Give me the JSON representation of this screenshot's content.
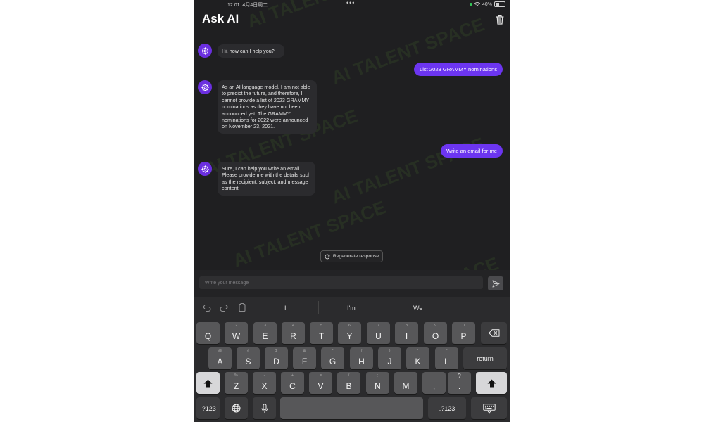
{
  "status_bar": {
    "time": "12:01",
    "date": "4月4日周二",
    "battery": "40%"
  },
  "header": {
    "title": "Ask AI"
  },
  "messages": [
    {
      "role": "ai",
      "text": "Hi, how can I help you?"
    },
    {
      "role": "user",
      "text": "List 2023 GRAMMY nominations"
    },
    {
      "role": "ai",
      "text": "As an AI language model, I am not able to predict the future, and therefore, I cannot provide a list of 2023 GRAMMY nominations as they have not been announced yet. The GRAMMY nominations for 2022 were announced on November 23, 2021."
    },
    {
      "role": "user",
      "text": "Write an email for me"
    },
    {
      "role": "ai",
      "text": "Sure, I can help you write an email. Please provide me with the details such as the recipient, subject, and message content."
    }
  ],
  "regenerate": {
    "label": "Regenerate response"
  },
  "composer": {
    "placeholder": "Write your message",
    "value": ""
  },
  "keyboard": {
    "suggestions": [
      "I",
      "I'm",
      "We"
    ],
    "row1": [
      {
        "hint": "1",
        "main": "Q"
      },
      {
        "hint": "2",
        "main": "W"
      },
      {
        "hint": "3",
        "main": "E"
      },
      {
        "hint": "4",
        "main": "R"
      },
      {
        "hint": "5",
        "main": "T"
      },
      {
        "hint": "6",
        "main": "Y"
      },
      {
        "hint": "7",
        "main": "U"
      },
      {
        "hint": "8",
        "main": "I"
      },
      {
        "hint": "9",
        "main": "O"
      },
      {
        "hint": "0",
        "main": "P"
      }
    ],
    "row2": [
      {
        "hint": "@",
        "main": "A"
      },
      {
        "hint": "#",
        "main": "S"
      },
      {
        "hint": "$",
        "main": "D"
      },
      {
        "hint": "&",
        "main": "F"
      },
      {
        "hint": "*",
        "main": "G"
      },
      {
        "hint": "(",
        "main": "H"
      },
      {
        "hint": ")",
        "main": "J"
      },
      {
        "hint": "'",
        "main": "K"
      },
      {
        "hint": "\"",
        "main": "L"
      }
    ],
    "row3": [
      {
        "hint": "%",
        "main": "Z"
      },
      {
        "hint": "-",
        "main": "X"
      },
      {
        "hint": "+",
        "main": "C"
      },
      {
        "hint": "=",
        "main": "V"
      },
      {
        "hint": "/",
        "main": "B"
      },
      {
        "hint": ";",
        "main": "N"
      },
      {
        "hint": ":",
        "main": "M"
      },
      {
        "hint": "!",
        "main": ","
      },
      {
        "hint": "?",
        "main": "."
      }
    ],
    "return_label": "return",
    "numbers_label": ".?123"
  }
}
